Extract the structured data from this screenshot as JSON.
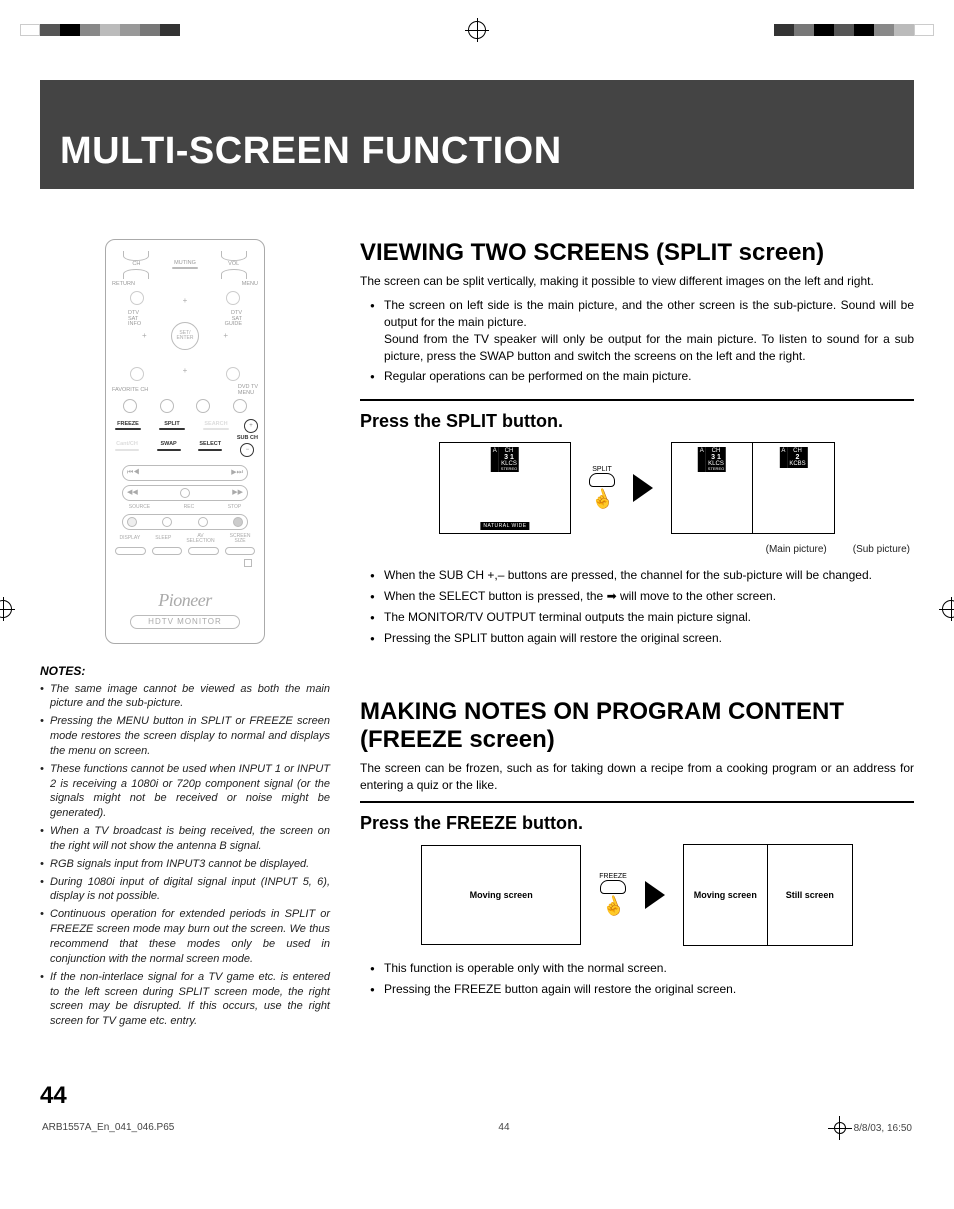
{
  "title": "MULTI-SCREEN FUNCTION",
  "remote": {
    "ch": "CH",
    "muting": "MUTING",
    "vol": "VOL",
    "return": "RETURN",
    "menu": "MENU",
    "setenter": "SET/\nENTER",
    "dtv_sat_info": "DTV\nSAT\nINFO",
    "dtv_sat_guide": "DTV\nSAT\nGUIDE",
    "favorite_ch": "FAVORITE CH",
    "dvd_tv_menu": "DVD TV\nMENU",
    "freeze": "FREEZE",
    "split": "SPLIT",
    "search": "SEARCH",
    "cantch": "Cant/CH",
    "swap": "SWAP",
    "select": "SELECT",
    "subch": "SUB CH",
    "source": "SOURCE",
    "rec": "REC",
    "stop": "STOP",
    "display": "DISPLAY",
    "sleep": "SLEEP",
    "avsel": "AV\nSELECTION",
    "screen": "SCREEN\nSIZE",
    "brand": "Pioneer",
    "model": "HDTV MONITOR"
  },
  "notes": {
    "head": "NOTES:",
    "items": [
      "The same image cannot be viewed as both the main picture and the sub-picture.",
      "Pressing the MENU button in SPLIT or FREEZE screen mode restores the screen display to normal and displays the menu on screen.",
      "These functions cannot be used when INPUT 1 or INPUT 2 is receiving a 1080i or 720p component signal (or the signals might not be received or noise might be generated).",
      "When a TV broadcast is being received, the screen on the right will not show the antenna B signal.",
      "RGB signals input from INPUT3 cannot be displayed.",
      "During 1080i input of digital signal input (INPUT 5, 6), display is not possible.",
      "Continuous operation for extended periods in SPLIT or FREEZE screen mode may burn out the screen. We thus recommend that these modes only be used in conjunction with the normal screen mode.",
      "If the non-interlace signal for a TV game etc. is entered to the left screen during SPLIT screen mode, the right screen may be disrupted. If this occurs, use the right screen for TV game etc. entry."
    ]
  },
  "split": {
    "heading": "VIEWING TWO SCREENS (SPLIT screen)",
    "intro": "The screen can be split vertically, making it possible to view different images on the left and right.",
    "top_bullets": [
      "The screen on left side is the main picture, and the other screen is the sub-picture. Sound will be output for the main picture.\nSound from the TV speaker will only be output for the main picture. To listen to sound for a sub picture, press the SWAP button and switch the screens on the left and the right.",
      "Regular operations can be performed on the main picture."
    ],
    "step": "Press the SPLIT button.",
    "badge1": {
      "a": "A",
      "ch": "CH",
      "n": "3 1",
      "call": "KLCS",
      "stereo": "STEREO",
      "mode": "NATURAL WIDE"
    },
    "badge2": {
      "a": "A",
      "ch": "CH",
      "n": "3 1",
      "call": "KLCS",
      "stereo": "STEREO"
    },
    "badge3": {
      "a": "A",
      "ch": "CH",
      "n": "2",
      "call": "KCBS"
    },
    "btn_label": "SPLIT",
    "cap_main": "(Main picture)",
    "cap_sub": "(Sub picture)",
    "bottom_bullets": [
      "When the SUB CH +,– buttons are pressed, the channel for the sub-picture will be changed.",
      "When the SELECT button is pressed, the ➡ will move to the other screen.",
      "The MONITOR/TV OUTPUT terminal outputs the main picture signal.",
      "Pressing the SPLIT button again will restore the original screen."
    ]
  },
  "freeze": {
    "heading": "MAKING NOTES ON PROGRAM CONTENT (FREEZE screen)",
    "intro": "The screen can be frozen, such as for taking down a recipe from a cooking program or an address for entering a quiz or the like.",
    "step": "Press the FREEZE button.",
    "btn_label": "FREEZE",
    "box1": "Moving screen",
    "box2a": "Moving screen",
    "box2b": "Still screen",
    "bullets": [
      "This function is operable only with the normal screen.",
      "Pressing the FREEZE button again will restore the original screen."
    ]
  },
  "page_num": "44",
  "footer": {
    "file": "ARB1557A_En_041_046.P65",
    "pg": "44",
    "date": "8/8/03, 16:50"
  }
}
